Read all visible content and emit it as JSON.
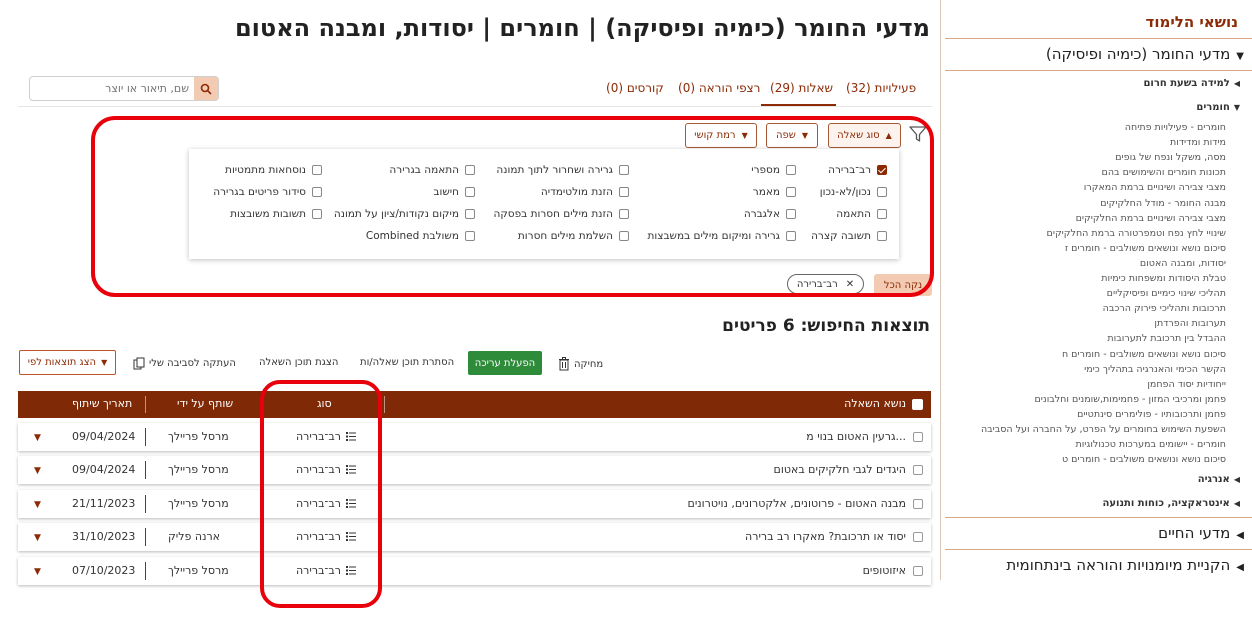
{
  "page_title": "מדעי החומר (כימיה ופיסיקה) | חומרים | יסודות, ומבנה האטום",
  "tabs": [
    {
      "label": "פעילויות (32)"
    },
    {
      "label": "שאלות (29)"
    },
    {
      "label": "רצפי הוראה (0)"
    },
    {
      "label": "קורסים (0)"
    }
  ],
  "search": {
    "placeholder": "שם, תיאור או יוצר"
  },
  "filters": {
    "question_type": "סוג שאלה",
    "language": "שפה",
    "difficulty": "רמת קושי",
    "options": [
      {
        "label": "רב־ברירה",
        "checked": true
      },
      {
        "label": "מספרי",
        "checked": false
      },
      {
        "label": "גרירה ושחרור לתוך תמונה",
        "checked": false
      },
      {
        "label": "התאמה בגרירה",
        "checked": false
      },
      {
        "label": "נוסחאות מתמטיות",
        "checked": false
      },
      {
        "label": "נכון/לא-נכון",
        "checked": false
      },
      {
        "label": "מאמר",
        "checked": false
      },
      {
        "label": "הזנת מולטימדיה",
        "checked": false
      },
      {
        "label": "חישוב",
        "checked": false
      },
      {
        "label": "סידור פריטים בגרירה",
        "checked": false
      },
      {
        "label": "התאמה",
        "checked": false
      },
      {
        "label": "אלגברה",
        "checked": false
      },
      {
        "label": "הזנת מילים חסרות בפסקה",
        "checked": false
      },
      {
        "label": "מיקום נקודות/ציון על תמונה",
        "checked": false
      },
      {
        "label": "תשובות משובצות",
        "checked": false
      },
      {
        "label": "תשובה קצרה",
        "checked": false
      },
      {
        "label": "גרירה ומיקום מילים במשבצות",
        "checked": false
      },
      {
        "label": "השלמת מילים חסרות",
        "checked": false
      },
      {
        "label": "משולבת Combined",
        "checked": false
      }
    ],
    "clear_all": "נקה הכל",
    "active_chip": "רב־ברירה"
  },
  "results": {
    "title": "תוצאות החיפוש: 6 פריטים",
    "toolbar": {
      "delete": "מחיקה",
      "edit": "הפעלת עריכה",
      "hide_content": "הסתרת תוכן שאלה/ות",
      "show_content": "הצגת תוכן השאלה",
      "copy": "העתקה לסביבה שלי",
      "show_by": "הצג תוצאות לפי"
    },
    "columns": {
      "topic": "נושא השאלה",
      "type": "סוג",
      "shared_by": "שותף על ידי",
      "share_date": "תאריך שיתוף"
    },
    "rows": [
      {
        "topic": "גרעין האטום בנוי מ...",
        "type": "רב־ברירה",
        "shared_by": "מרסל פריילך",
        "date": "09/04/2024"
      },
      {
        "topic": "היגדים לגבי חלקיקים באטום",
        "type": "רב־ברירה",
        "shared_by": "מרסל פריילך",
        "date": "09/04/2024"
      },
      {
        "topic": "מבנה האטום - פרוטונים, אלקטרונים, נויטרונים",
        "type": "רב־ברירה",
        "shared_by": "מרסל פריילך",
        "date": "21/11/2023"
      },
      {
        "topic": "יסוד או תרכובת? מאקרו רב ברירה",
        "type": "רב־ברירה",
        "shared_by": "ארנה פליק",
        "date": "31/10/2023"
      },
      {
        "topic": "איזוטופים",
        "type": "רב־ברירה",
        "shared_by": "מרסל פריילך",
        "date": "07/10/2023"
      }
    ]
  },
  "sidebar": {
    "title": "נושאי הלימוד",
    "main_topic": "מדעי החומר (כימיה ופיסיקה)",
    "sub1": "למידה בשעת חרום",
    "sub2": "חומרים",
    "leaves": [
      "חומרים - פעילויות פתיחה",
      "מידות ומדידות",
      "מסה, משקל ונפח של גופים",
      "תכונות חומרים והשימושים בהם",
      "מצבי צבירה ושינויים ברמת המאקרו",
      "מבנה החומר - מודל החלקיקים",
      "מצבי צבירה ושינויים ברמת החלקיקים",
      "שינויי לחץ נפח וטמפרטורה ברמת החלקיקים",
      "סיכום נושא ונושאים משולבים - חומרים ז",
      "יסודות, ומבנה האטום",
      "טבלת היסודות ומשפחות כימיות",
      "תהליכי שינוי כימיים ופיסיקליים",
      "תרכובות ותהליכי פירוק הרכבה",
      "תערובות והפרדתן",
      "ההבדל בין תרכובת לתערובות",
      "סיכום נושא ונושאים משולבים - חומרים ח",
      "הקשר הכימי והאנרגיה בתהליך כימי",
      "ייחודיות יסוד הפחמן",
      "פחמן ומרכיבי המזון - פחמימות,שומנים וחלבונים",
      "פחמן ותרכובותיו - פולימרים סינתטיים",
      "השפעת השימוש בחומרים על הפרט, על החברה ועל הסביבה",
      "חומרים - יישומים במערכות טכנולוגיות",
      "סיכום נושא ונושאים משולבים - חומרים ט"
    ],
    "sub3": "אנרגיה",
    "sub4": "אינטראקציה, כוחות ותנועה",
    "main2": "מדעי החיים",
    "main3": "הקניית מיומנויות והוראה בינתחומית"
  },
  "colors": {
    "accent": "#8b2a05",
    "header_bg": "#7f2906",
    "edit_green": "#2e8b3a",
    "annotation_red": "#e8000b"
  }
}
